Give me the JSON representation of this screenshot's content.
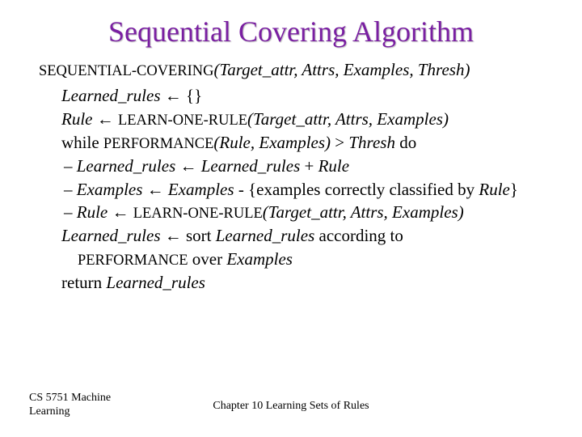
{
  "title": "Sequential Covering Algorithm",
  "sig": {
    "fn": "SEQUENTIAL-COVERING",
    "args": "(Target_attr, Attrs, Examples, Thresh)"
  },
  "l1a": "Learned_rules",
  "l1b": " ← {}",
  "l2a": "Rule",
  "l2b": " ← ",
  "l2c": "LEARN-ONE-RULE",
  "l2d": "(Target_attr, Attrs, Examples)",
  "l3a": "while ",
  "l3b": "PERFORMANCE",
  "l3c": "(Rule, Examples)",
  "l3d": " > ",
  "l3e": "Thresh",
  "l3f": " do",
  "d1a": "Learned_rules",
  "d1b": " ← ",
  "d1c": "Learned_rules",
  "d1d": " + ",
  "d1e": "Rule",
  "d2a": "Examples",
  "d2b": " ← ",
  "d2c": "Examples",
  "d2d": " - {examples correctly classified by ",
  "d2e": "Rule",
  "d2f": "}",
  "d3a": "Rule",
  "d3b": " ← ",
  "d3c": "LEARN-ONE-RULE",
  "d3d": "(Target_attr, Attrs, Examples)",
  "l4a": "Learned_rules",
  "l4b": " ← sort ",
  "l4c": "Learned_rules",
  "l4d": " according to",
  "l5a": "PERFORMANCE",
  "l5b": " over ",
  "l5c": "Examples",
  "l6a": "return ",
  "l6b": "Learned_rules",
  "footer_left_1": "CS 5751 Machine",
  "footer_left_2": "Learning",
  "footer_center": "Chapter 10  Learning Sets of Rules"
}
